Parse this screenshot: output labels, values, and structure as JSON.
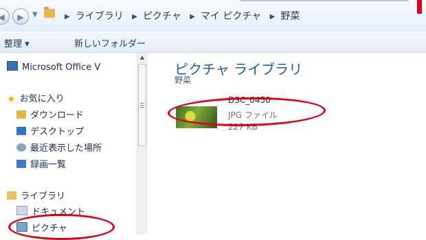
{
  "address_bar": {
    "breadcrumbs": [
      "ライブラリ",
      "ピクチャ",
      "マイ ピクチャ",
      "野菜"
    ],
    "back_icon": "arrow-left-icon",
    "forward_icon": "arrow-right-icon"
  },
  "toolbar": {
    "organize_label": "整理 ▾",
    "new_folder_label": "新しいフォルダー"
  },
  "sidebar": {
    "items": [
      {
        "label": "Microsoft Office V",
        "icon": "office-icon"
      },
      {
        "label": "お気に入り",
        "icon": "star-icon"
      },
      {
        "label": "ダウンロード",
        "icon": "download-folder-icon"
      },
      {
        "label": "デスクトップ",
        "icon": "desktop-icon"
      },
      {
        "label": "最近表示した場所",
        "icon": "recent-places-icon"
      },
      {
        "label": "録画一覧",
        "icon": "recording-icon"
      },
      {
        "label": "ライブラリ",
        "icon": "library-icon"
      },
      {
        "label": "ドキュメント",
        "icon": "documents-icon"
      },
      {
        "label": "ピクチャ",
        "icon": "pictures-icon"
      }
    ]
  },
  "main": {
    "library_title": "ピクチャ ライブラリ",
    "library_subtitle": "野菜",
    "file": {
      "name": "DSC_0450",
      "type": "JPG ファイル",
      "size": "227 KB"
    }
  },
  "colors": {
    "annotation": "#e10014",
    "title": "#1c5c9a"
  }
}
